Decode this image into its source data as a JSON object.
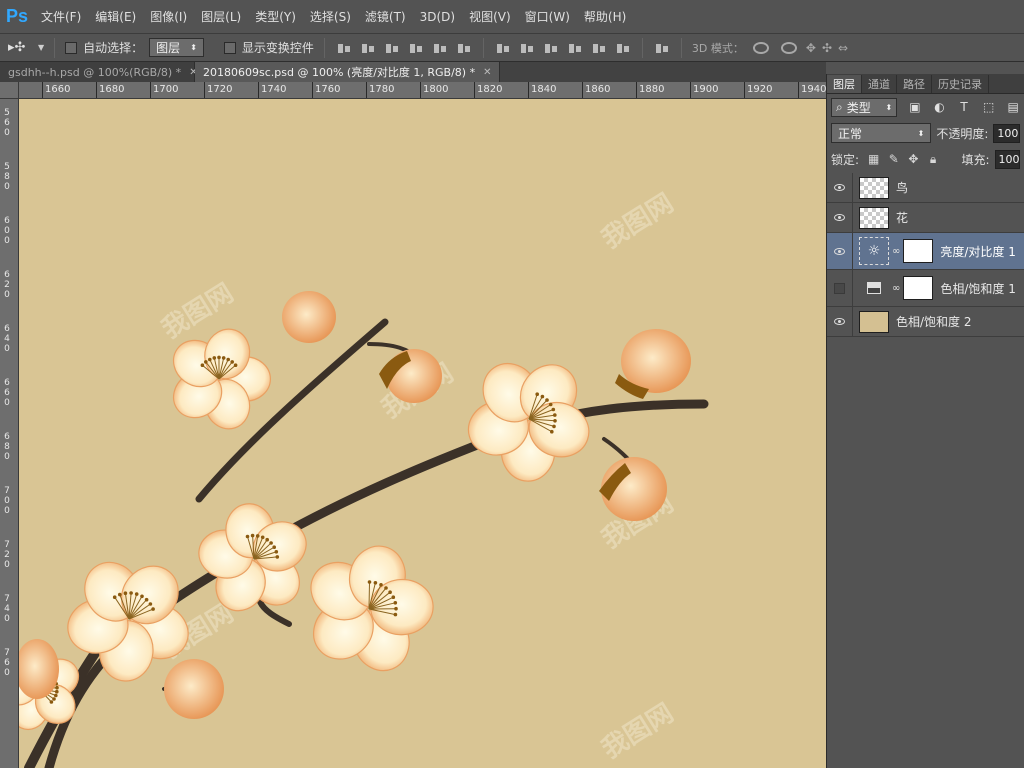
{
  "app": {
    "logo": "Ps"
  },
  "menu": [
    "文件(F)",
    "编辑(E)",
    "图像(I)",
    "图层(L)",
    "类型(Y)",
    "选择(S)",
    "滤镜(T)",
    "3D(D)",
    "视图(V)",
    "窗口(W)",
    "帮助(H)"
  ],
  "options": {
    "auto_select_label": "自动选择：",
    "auto_select_value": "图层",
    "show_transform_label": "显示变换控件",
    "mode3d_label": "3D 模式："
  },
  "tabs": [
    {
      "label": "gsdhh--h.psd @ 100%(RGB/8) *",
      "active": false
    },
    {
      "label": "20180609sc.psd @ 100% (亮度/对比度 1, RGB/8) *",
      "active": true
    }
  ],
  "ruler": {
    "h_ticks": [
      "1660",
      "1680",
      "1700",
      "1720",
      "1740",
      "1760",
      "1780",
      "1800",
      "1820",
      "1840",
      "1860",
      "1880",
      "1900",
      "1920",
      "1940"
    ],
    "v_ticks": [
      "560",
      "580",
      "600",
      "620",
      "640",
      "660",
      "680",
      "700",
      "720",
      "740",
      "760"
    ]
  },
  "panel": {
    "tabs": [
      "图层",
      "通道",
      "路径",
      "历史记录"
    ],
    "filter_label": "类型",
    "blend_mode": "正常",
    "opacity_label": "不透明度:",
    "opacity_value": "100%",
    "lock_label": "锁定:",
    "fill_label": "填充:",
    "fill_value": "100%"
  },
  "layers": [
    {
      "name": "鸟",
      "visible": true,
      "kind": "pixel",
      "selected": false
    },
    {
      "name": "花",
      "visible": true,
      "kind": "pixel",
      "selected": false
    },
    {
      "name": "亮度/对比度 1",
      "visible": true,
      "kind": "brightness-contrast",
      "selected": true
    },
    {
      "name": "色相/饱和度 1",
      "visible": false,
      "kind": "hue-saturation",
      "selected": false
    },
    {
      "name": "色相/饱和度 2",
      "visible": true,
      "kind": "fill",
      "selected": false
    }
  ],
  "colors": {
    "ui_bg": "#535353",
    "canvas_bg": "#d9c594",
    "selected_layer": "#607390",
    "petal": "#fcebc4",
    "petal_edge": "#e89b5a",
    "branch": "#3b3128"
  },
  "watermark": "我图网"
}
